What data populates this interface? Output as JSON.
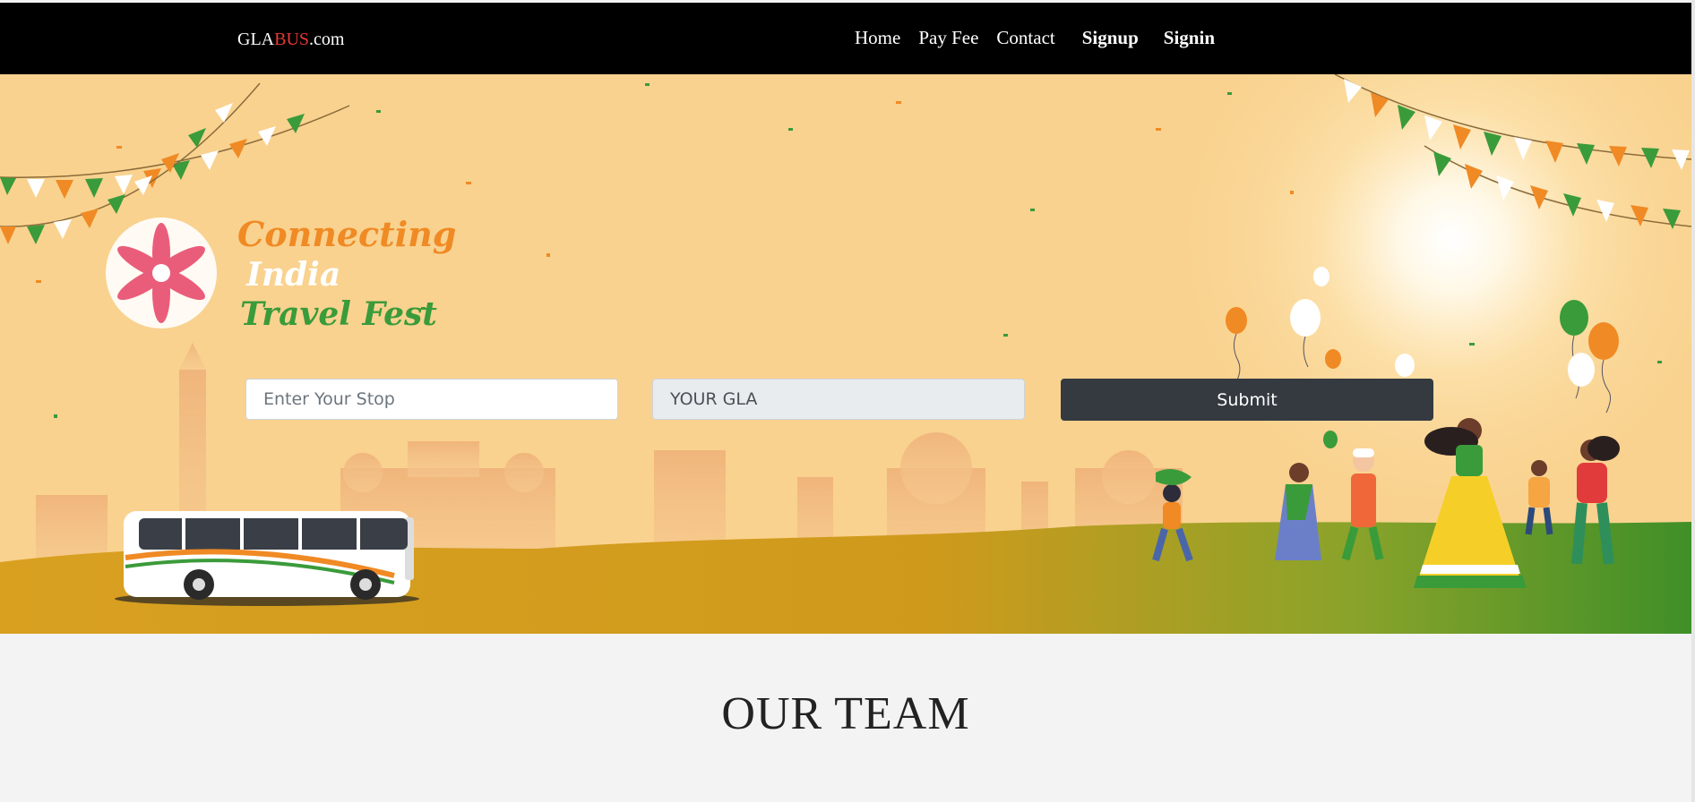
{
  "navbar": {
    "brand": {
      "prefix": "GLA",
      "accent": "BUS",
      "suffix": ".com"
    },
    "links": [
      {
        "label": "Home"
      },
      {
        "label": "Pay Fee"
      },
      {
        "label": "Contact"
      },
      {
        "label": "Signup"
      },
      {
        "label": "Signin"
      }
    ]
  },
  "hero": {
    "logo_lines": [
      "Connecting",
      "India",
      "Travel Fest"
    ]
  },
  "form": {
    "stop_placeholder": "Enter Your Stop",
    "gla_value": "YOUR GLA",
    "submit_label": "Submit"
  },
  "team": {
    "title": "OUR TEAM"
  },
  "colors": {
    "navbar_bg": "#000000",
    "brand_accent": "#e53935",
    "hero_bg": "#f9d28f",
    "button_bg": "#343a40",
    "saffron": "#f08a24",
    "green": "#3a9b3a"
  }
}
